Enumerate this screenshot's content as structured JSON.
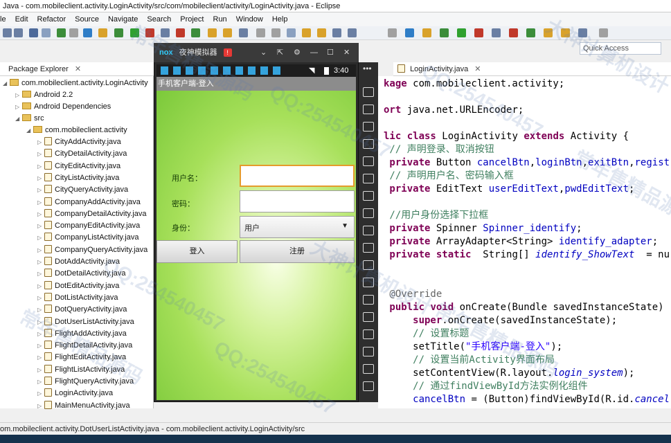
{
  "window": {
    "title": "Java - com.mobileclient.activity.LoginActivity/src/com/mobileclient/activity/LoginActivity.java - Eclipse"
  },
  "menu": [
    "le",
    "Edit",
    "Refactor",
    "Source",
    "Navigate",
    "Search",
    "Project",
    "Run",
    "Window",
    "Help"
  ],
  "quick_access": {
    "placeholder": "Quick Access"
  },
  "package_explorer": {
    "tab_label": "Package Explorer",
    "project": "com.mobileclient.activity.LoginActivity",
    "android_lib": "Android 2.2",
    "android_deps": "Android Dependencies",
    "src": "src",
    "package": "com.mobileclient.activity",
    "files": [
      "CityAddActivity.java",
      "CityDetailActivity.java",
      "CityEditActivity.java",
      "CityListActivity.java",
      "CityQueryActivity.java",
      "CompanyAddActivity.java",
      "CompanyDetailActivity.java",
      "CompanyEditActivity.java",
      "CompanyListActivity.java",
      "CompanyQueryActivity.java",
      "DotAddActivity.java",
      "DotDetailActivity.java",
      "DotEditActivity.java",
      "DotListActivity.java",
      "DotQueryActivity.java",
      "DotUserListActivity.java",
      "FlightAddActivity.java",
      "FlightDetailActivity.java",
      "FlightEditActivity.java",
      "FlightListActivity.java",
      "FlightQueryActivity.java",
      "LoginActivity.java",
      "MainMenuActivity.java"
    ]
  },
  "emulator": {
    "brand": "nox",
    "title": "夜神模拟器",
    "badge": "!",
    "time": "3:40",
    "app_title": "手机客户端-登入",
    "username_label": "用户名：",
    "password_label": "密码：",
    "identity_label": "身份：",
    "identity_value": "用户",
    "login_button": "登入",
    "register_button": "注册"
  },
  "editor": {
    "tab_label": "LoginActivity.java",
    "lines": [
      [
        {
          "t": "kage com.mobileclient.activity;",
          "c": "kw0"
        }
      ],
      [],
      [
        {
          "t": "ort java.net.URLEncoder;",
          "c": "kw0"
        }
      ],
      [],
      [
        {
          "t": "lic ",
          "c": "kw"
        },
        {
          "t": "class ",
          "c": "kw"
        },
        {
          "t": "LoginActivity ",
          "c": ""
        },
        {
          "t": "extends ",
          "c": "kw"
        },
        {
          "t": "Activity {",
          "c": ""
        }
      ],
      [
        {
          "t": " // 声明登录、取消按钮",
          "c": "cm"
        }
      ],
      [
        {
          "t": " private ",
          "c": "kw"
        },
        {
          "t": "Button ",
          "c": ""
        },
        {
          "t": "cancelBtn",
          "c": "fd"
        },
        {
          "t": ",",
          "c": ""
        },
        {
          "t": "loginBtn",
          "c": "fd"
        },
        {
          "t": ",",
          "c": ""
        },
        {
          "t": "exitBtn",
          "c": "fd"
        },
        {
          "t": ",",
          "c": ""
        },
        {
          "t": "regist",
          "c": "fd"
        }
      ],
      [
        {
          "t": " // 声明用户名、密码输入框",
          "c": "cm"
        }
      ],
      [
        {
          "t": " private ",
          "c": "kw"
        },
        {
          "t": "EditText ",
          "c": ""
        },
        {
          "t": "userEditText",
          "c": "fd"
        },
        {
          "t": ",",
          "c": ""
        },
        {
          "t": "pwdEditText",
          "c": "fd"
        },
        {
          "t": ";",
          "c": ""
        }
      ],
      [],
      [
        {
          "t": " //用户身份选择下拉框",
          "c": "cm"
        }
      ],
      [
        {
          "t": " private ",
          "c": "kw"
        },
        {
          "t": "Spinner ",
          "c": ""
        },
        {
          "t": "Spinner_identify",
          "c": "fd"
        },
        {
          "t": ";",
          "c": ""
        }
      ],
      [
        {
          "t": " private ",
          "c": "kw"
        },
        {
          "t": "ArrayAdapter<String> ",
          "c": ""
        },
        {
          "t": "identify_adapter",
          "c": "fd"
        },
        {
          "t": ";",
          "c": ""
        }
      ],
      [
        {
          "t": " private ",
          "c": "kw"
        },
        {
          "t": "static  ",
          "c": "kw"
        },
        {
          "t": "String[] ",
          "c": ""
        },
        {
          "t": "identify_ShowText",
          "c": "fd it"
        },
        {
          "t": "  = nu",
          "c": ""
        }
      ],
      [],
      [],
      [
        {
          "t": " @Override",
          "c": "an"
        }
      ],
      [
        {
          "t": " public ",
          "c": "kw"
        },
        {
          "t": "void ",
          "c": "kw"
        },
        {
          "t": "onCreate(Bundle savedInstanceState)",
          "c": ""
        }
      ],
      [
        {
          "t": "     super",
          "c": "kw"
        },
        {
          "t": ".onCreate(savedInstanceState);",
          "c": ""
        }
      ],
      [
        {
          "t": "     // 设置标题",
          "c": "cm"
        }
      ],
      [
        {
          "t": "     setTitle(",
          "c": ""
        },
        {
          "t": "\"手机客户端-登入\"",
          "c": "st"
        },
        {
          "t": ");",
          "c": ""
        }
      ],
      [
        {
          "t": "     // 设置当前Activity界面布局",
          "c": "cm"
        }
      ],
      [
        {
          "t": "     setContentView(R.layout.",
          "c": ""
        },
        {
          "t": "login_system",
          "c": "fd it"
        },
        {
          "t": ");",
          "c": ""
        }
      ],
      [
        {
          "t": "     // 通过findViewById方法实例化组件",
          "c": "cm"
        }
      ],
      [
        {
          "t": "     cancelBtn",
          "c": "fd"
        },
        {
          "t": " = (Button)findViewById(R.id.",
          "c": ""
        },
        {
          "t": "cancel",
          "c": "fd it"
        }
      ]
    ]
  },
  "status_line": "om.mobileclient.activity.DotUserListActivity.java - com.mobileclient.activity.LoginActivity/src",
  "watermarks": [
    "QQ:254540457",
    "常年售精品源码",
    "大神计算机设计"
  ]
}
